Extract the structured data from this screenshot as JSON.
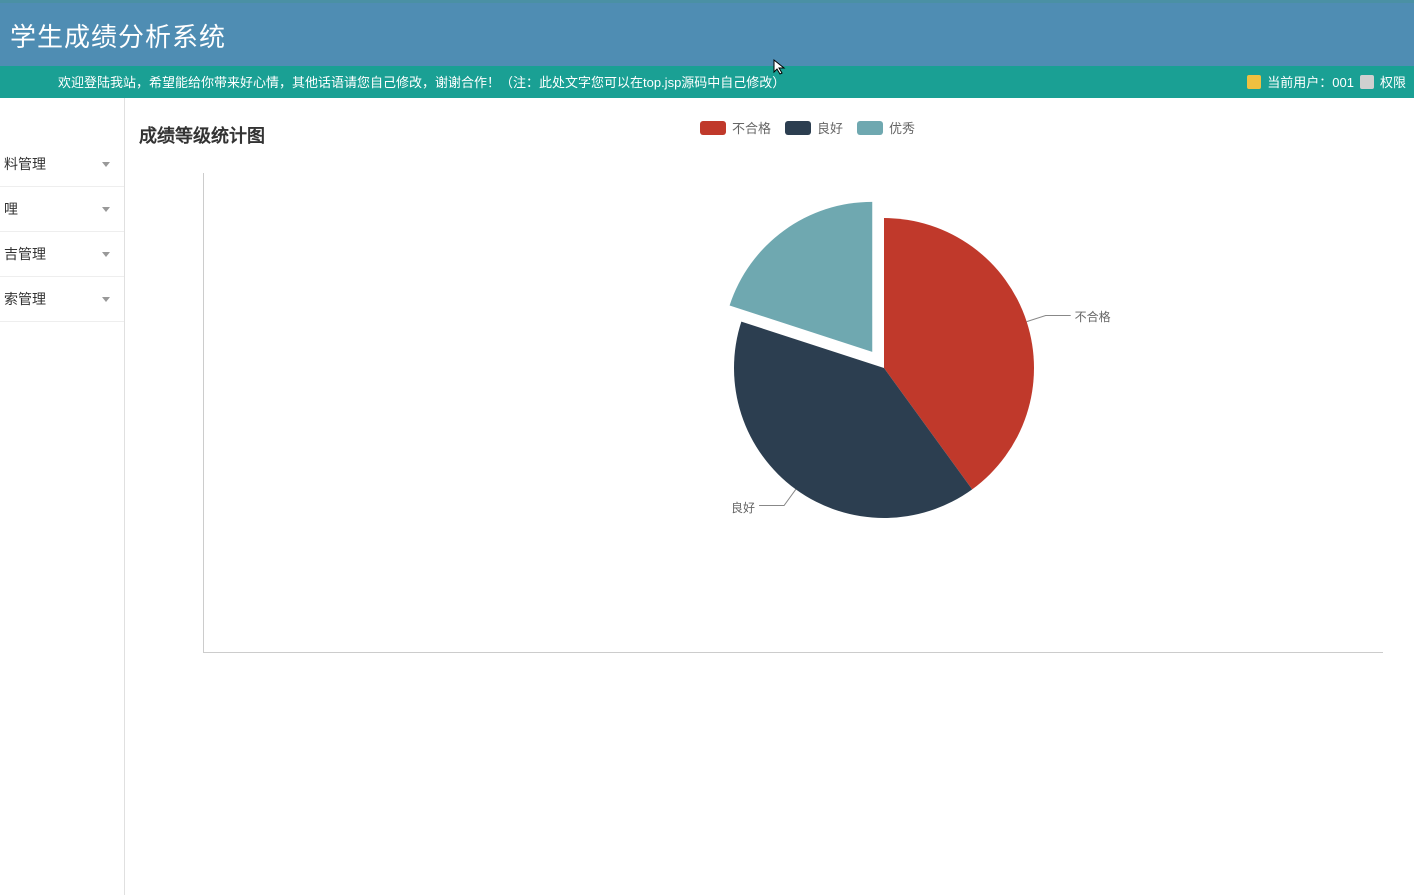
{
  "header": {
    "title": "学生成绩分析系统"
  },
  "infobar": {
    "welcome": "欢迎登陆我站，希望能给你带来好心情，其他话语请您自己修改，谢谢合作！（注：此处文字您可以在top.jsp源码中自己修改）",
    "current_user_label": "当前用户：001",
    "perm_label": "权限"
  },
  "sidebar": {
    "items": [
      {
        "label": "料管理"
      },
      {
        "label": "哩"
      },
      {
        "label": "吉管理"
      },
      {
        "label": "索管理"
      }
    ]
  },
  "chart": {
    "title": "成绩等级统计图"
  },
  "legend": {
    "items": [
      {
        "label": "不合格",
        "color": "#c0392b"
      },
      {
        "label": "良好",
        "color": "#2c3e50"
      },
      {
        "label": "优秀",
        "color": "#6fa8b0"
      }
    ]
  },
  "labels": {
    "fail": "不合格",
    "good": "良好"
  },
  "colors": {
    "fail": "#c0392b",
    "good": "#2c3e50",
    "excellent": "#6fa8b0"
  },
  "chart_data": {
    "type": "pie",
    "title": "成绩等级统计图",
    "series": [
      {
        "name": "不合格",
        "value": 40,
        "color": "#c0392b"
      },
      {
        "name": "良好",
        "value": 40,
        "color": "#2c3e50"
      },
      {
        "name": "优秀",
        "value": 20,
        "color": "#6fa8b0"
      }
    ],
    "exploded_slice": "优秀",
    "labels_shown": [
      "不合格",
      "良好"
    ]
  }
}
